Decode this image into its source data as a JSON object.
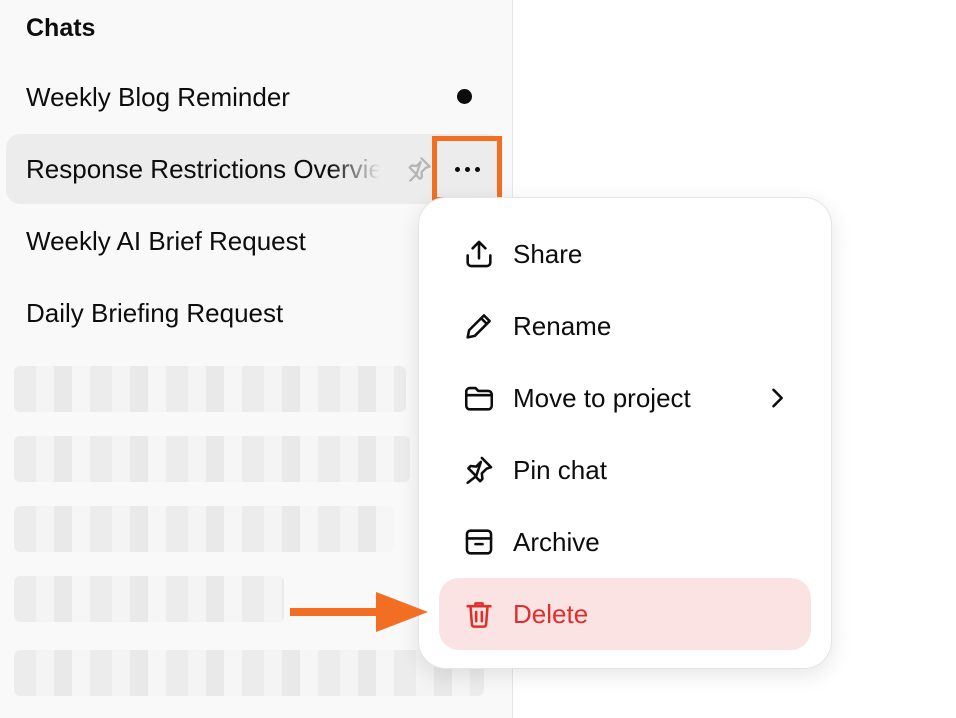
{
  "sidebar": {
    "section_title": "Chats",
    "chats": [
      {
        "label": "Weekly Blog Reminder",
        "unread": true
      },
      {
        "label": "Response Restrictions Overview",
        "active": true
      },
      {
        "label": "Weekly AI Brief Request"
      },
      {
        "label": "Daily Briefing Request"
      }
    ]
  },
  "menu": {
    "items": [
      {
        "label": "Share",
        "icon": "share-icon"
      },
      {
        "label": "Rename",
        "icon": "pencil-icon"
      },
      {
        "label": "Move to project",
        "icon": "folder-icon"
      },
      {
        "label": "Pin chat",
        "icon": "pin-icon"
      },
      {
        "label": "Archive",
        "icon": "archive-icon"
      },
      {
        "label": "Delete",
        "icon": "trash-icon"
      }
    ]
  },
  "colors": {
    "highlight": "#f26e22",
    "danger": "#e02e2a",
    "danger_bg": "#fbe3e3"
  }
}
